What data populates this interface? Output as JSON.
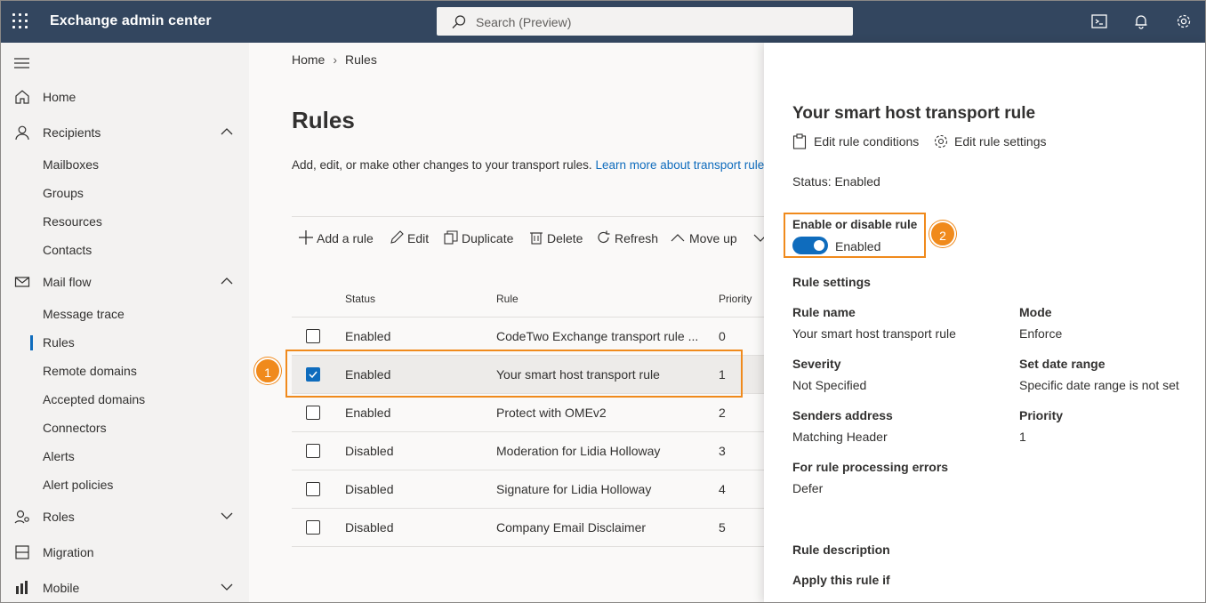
{
  "topbar": {
    "app_title": "Exchange admin center",
    "search_placeholder": "Search (Preview)"
  },
  "sidebar": {
    "items": [
      {
        "label": "Home"
      },
      {
        "label": "Recipients"
      },
      {
        "label": "Mailboxes"
      },
      {
        "label": "Groups"
      },
      {
        "label": "Resources"
      },
      {
        "label": "Contacts"
      },
      {
        "label": "Mail flow"
      },
      {
        "label": "Message trace"
      },
      {
        "label": "Rules"
      },
      {
        "label": "Remote domains"
      },
      {
        "label": "Accepted domains"
      },
      {
        "label": "Connectors"
      },
      {
        "label": "Alerts"
      },
      {
        "label": "Alert policies"
      },
      {
        "label": "Roles"
      },
      {
        "label": "Migration"
      },
      {
        "label": "Mobile"
      }
    ]
  },
  "breadcrumb": {
    "home": "Home",
    "current": "Rules"
  },
  "main": {
    "title": "Rules",
    "description": "Add, edit, or make other changes to your transport rules. ",
    "description_link": "Learn more about transport rules"
  },
  "toolbar": {
    "add": "Add a rule",
    "edit": "Edit",
    "duplicate": "Duplicate",
    "delete": "Delete",
    "refresh": "Refresh",
    "move_up": "Move up"
  },
  "table": {
    "headers": {
      "status": "Status",
      "rule": "Rule",
      "priority": "Priority"
    },
    "rows": [
      {
        "status": "Enabled",
        "rule": "CodeTwo Exchange transport rule ...",
        "priority": "0",
        "checked": false
      },
      {
        "status": "Enabled",
        "rule": "Your smart host transport rule",
        "priority": "1",
        "checked": true
      },
      {
        "status": "Enabled",
        "rule": "Protect with OMEv2",
        "priority": "2",
        "checked": false
      },
      {
        "status": "Disabled",
        "rule": "Moderation for Lidia Holloway",
        "priority": "3",
        "checked": false
      },
      {
        "status": "Disabled",
        "rule": "Signature for Lidia Holloway",
        "priority": "4",
        "checked": false
      },
      {
        "status": "Disabled",
        "rule": "Company Email Disclaimer",
        "priority": "5",
        "checked": false
      }
    ]
  },
  "panel": {
    "title": "Your smart host transport rule",
    "edit_conditions": "Edit rule conditions",
    "edit_settings": "Edit rule settings",
    "status": "Status: Enabled",
    "toggle_heading": "Enable or disable rule",
    "toggle_label": "Enabled",
    "settings_heading": "Rule settings",
    "rule_name_label": "Rule name",
    "rule_name_value": "Your smart host transport rule",
    "mode_label": "Mode",
    "mode_value": "Enforce",
    "severity_label": "Severity",
    "severity_value": "Not Specified",
    "date_range_label": "Set date range",
    "date_range_value": "Specific date range is not set",
    "senders_label": "Senders address",
    "senders_value": "Matching Header",
    "priority_label": "Priority",
    "priority_value": "1",
    "errors_label": "For rule processing errors",
    "errors_value": "Defer",
    "description_heading": "Rule description",
    "apply_label": "Apply this rule if"
  },
  "callouts": {
    "one": "1",
    "two": "2"
  },
  "colors": {
    "topbar": "#33465f",
    "accent": "#0f6cbd",
    "callout": "#f08a1c"
  }
}
